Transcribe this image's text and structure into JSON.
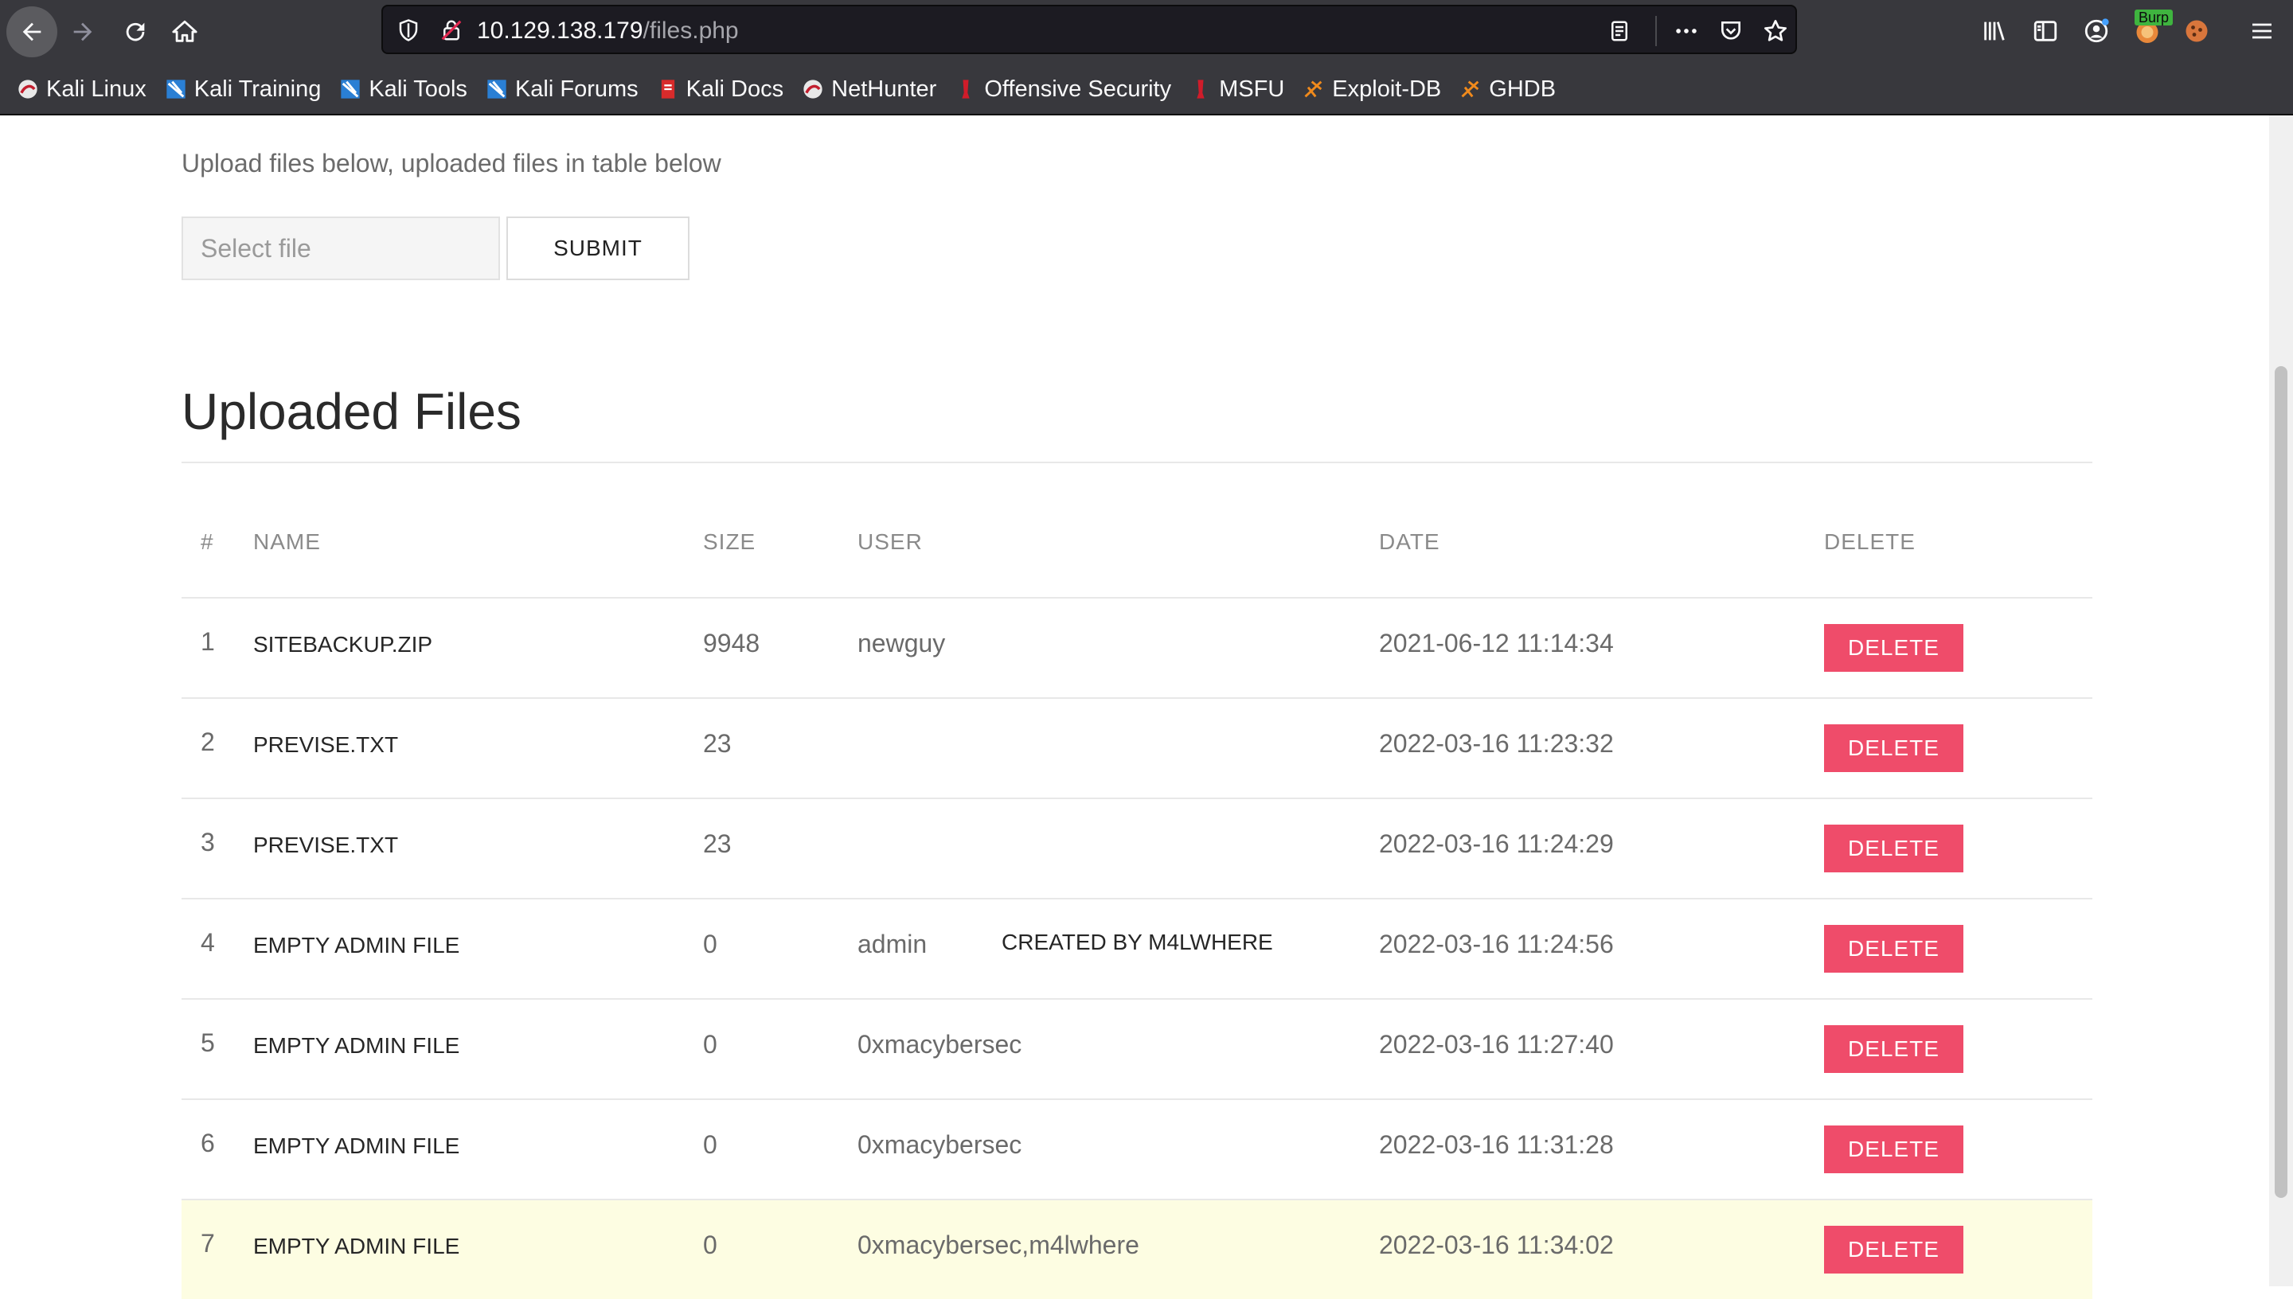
{
  "browser": {
    "url_host": "10.129.138.179",
    "url_path": "/files.php",
    "burp_label": "Burp",
    "bookmarks": [
      {
        "label": "Kali Linux",
        "icon": "kali-icon"
      },
      {
        "label": "Kali Training",
        "icon": "kali-training-icon"
      },
      {
        "label": "Kali Tools",
        "icon": "kali-tools-icon"
      },
      {
        "label": "Kali Forums",
        "icon": "kali-forums-icon"
      },
      {
        "label": "Kali Docs",
        "icon": "kali-docs-icon"
      },
      {
        "label": "NetHunter",
        "icon": "nethunter-icon"
      },
      {
        "label": "Offensive Security",
        "icon": "offsec-icon"
      },
      {
        "label": "MSFU",
        "icon": "msfu-icon"
      },
      {
        "label": "Exploit-DB",
        "icon": "exploitdb-icon"
      },
      {
        "label": "GHDB",
        "icon": "ghdb-icon"
      }
    ]
  },
  "upload": {
    "intro": "Upload files below, uploaded files in table below",
    "file_placeholder": "Select file",
    "submit_label": "SUBMIT"
  },
  "files": {
    "title": "Uploaded Files",
    "headers": {
      "num": "#",
      "name": "NAME",
      "size": "SIZE",
      "user": "USER",
      "date": "DATE",
      "delete": "DELETE"
    },
    "rows": [
      {
        "num": "1",
        "name": "SITEBACKUP.ZIP",
        "size": "9948",
        "user": "newguy",
        "note": "",
        "date": "2021-06-12 11:14:34",
        "delete": "DELETE"
      },
      {
        "num": "2",
        "name": "PREVISE.TXT",
        "size": "23",
        "user": "",
        "note": "",
        "date": "2022-03-16 11:23:32",
        "delete": "DELETE"
      },
      {
        "num": "3",
        "name": "PREVISE.TXT",
        "size": "23",
        "user": "",
        "note": "",
        "date": "2022-03-16 11:24:29",
        "delete": "DELETE"
      },
      {
        "num": "4",
        "name": "EMPTY ADMIN FILE",
        "size": "0",
        "user": "admin",
        "note": "CREATED BY M4LWHERE",
        "date": "2022-03-16 11:24:56",
        "delete": "DELETE"
      },
      {
        "num": "5",
        "name": "EMPTY ADMIN FILE",
        "size": "0",
        "user": "0xmacybersec",
        "note": "",
        "date": "2022-03-16 11:27:40",
        "delete": "DELETE"
      },
      {
        "num": "6",
        "name": "EMPTY ADMIN FILE",
        "size": "0",
        "user": "0xmacybersec",
        "note": "",
        "date": "2022-03-16 11:31:28",
        "delete": "DELETE"
      },
      {
        "num": "7",
        "name": "EMPTY ADMIN FILE",
        "size": "0",
        "user": "0xmacybersec,m4lwhere",
        "note": "",
        "date": "2022-03-16 11:34:02",
        "delete": "DELETE"
      }
    ]
  },
  "colors": {
    "chrome": "#38383d",
    "delete_button": "#ef4c6a",
    "highlight_row": "#fdfde2"
  }
}
